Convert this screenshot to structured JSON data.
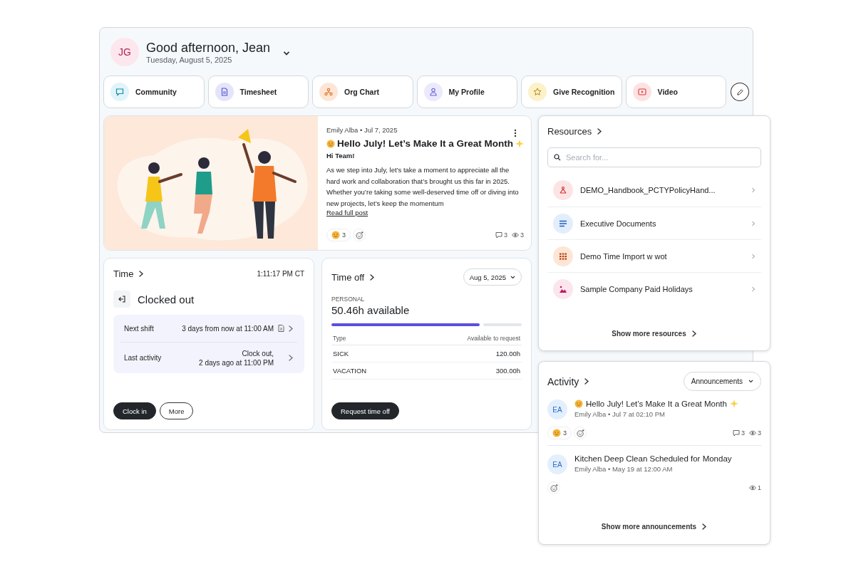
{
  "header": {
    "initials": "JG",
    "greeting": "Good afternoon, Jean",
    "date": "Tuesday, August 5, 2025"
  },
  "quick_links": [
    {
      "label": "Community"
    },
    {
      "label": "Timesheet"
    },
    {
      "label": "Org Chart"
    },
    {
      "label": "My Profile"
    },
    {
      "label": "Give Recognition"
    },
    {
      "label": "Video"
    }
  ],
  "post": {
    "meta": "Emily Alba • Jul 7, 2025",
    "title": "Hello July! Let’s Make It a Great Month",
    "greeting": "Hi Team!",
    "body": "As we step into July, let’s take a moment to appreciate all the hard work and collaboration that’s brought us this far in 2025. Whether you’re taking some well-deserved time off or diving into new projects, let’s keep the momentum",
    "link": "Read full post",
    "reactions": "3",
    "comments": "3",
    "views": "3"
  },
  "time": {
    "title": "Time",
    "clock": "1:11:17 PM CT",
    "status": "Clocked out",
    "rows": [
      {
        "label": "Next shift",
        "value": [
          "3 days from now at 11:00 AM"
        ],
        "kind": "document"
      },
      {
        "label": "Last activity",
        "value": [
          "Clock out,",
          "2 days ago at 11:00 PM"
        ],
        "kind": "plain"
      }
    ],
    "buttons": [
      {
        "label": "Clock in",
        "kind": "primary"
      },
      {
        "label": "More",
        "kind": "outline"
      }
    ]
  },
  "time_off": {
    "title": "Time off",
    "date": "Aug 5, 2025",
    "category": "PERSONAL",
    "available": "50.46h available",
    "level": 0.78,
    "columns": [
      "Type",
      "Available to request"
    ],
    "rows": [
      [
        "SICK",
        "120.00h"
      ],
      [
        "VACATION",
        "300.00h"
      ]
    ],
    "button": "Request time off"
  },
  "resources": {
    "title": "Resources",
    "search": {
      "placeholder": "Search for..."
    },
    "items": [
      {
        "label": "DEMO_Handbook_PCTYPolicyHand..."
      },
      {
        "label": "Executive Documents"
      },
      {
        "label": "Demo Time Import w wot"
      },
      {
        "label": "Sample Company Paid Holidays"
      }
    ],
    "more": "Show more resources"
  },
  "activity": {
    "title": "Activity",
    "filter": "Announcements",
    "items": [
      {
        "initials": "EA",
        "decorated": true,
        "title": "Hello July! Let’s Make It a Great Month",
        "meta": "Emily Alba • Jul 7 at 02:10 PM",
        "reactions": "3",
        "comments": "3",
        "views": "3"
      },
      {
        "initials": "EA",
        "decorated": false,
        "title": "Kitchen Deep Clean Scheduled for Monday",
        "meta": "Emily Alba • May 19 at 12:00 AM",
        "views": "1"
      }
    ],
    "more": "Show more announcements"
  }
}
